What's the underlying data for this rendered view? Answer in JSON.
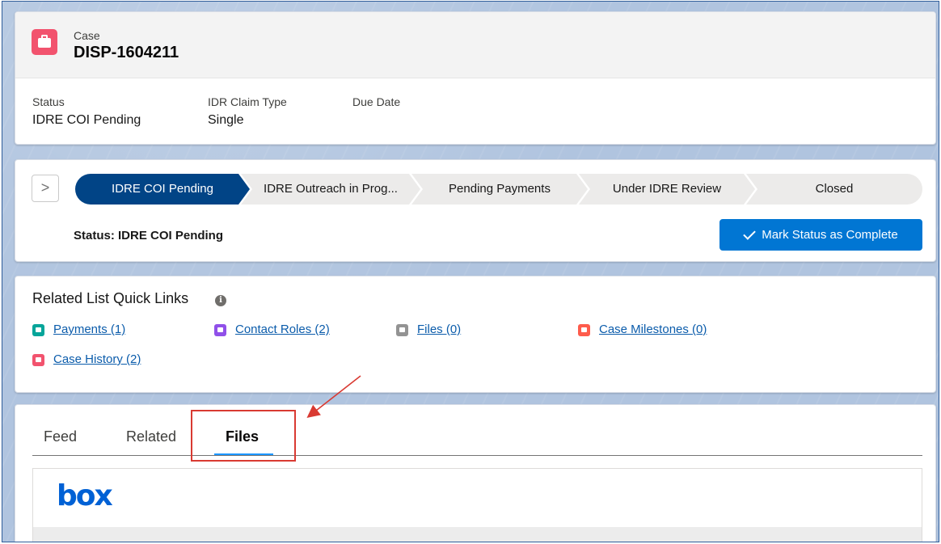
{
  "header": {
    "object_label": "Case",
    "record_number": "DISP-1604211",
    "fields": [
      {
        "label": "Status",
        "value": "IDRE COI Pending"
      },
      {
        "label": "IDR Claim Type",
        "value": "Single"
      },
      {
        "label": "Due Date",
        "value": ""
      }
    ]
  },
  "path": {
    "toggle_symbol": ">",
    "stages": [
      {
        "label": "IDRE COI Pending",
        "active": true
      },
      {
        "label": "IDRE Outreach in Prog...",
        "active": false
      },
      {
        "label": "Pending Payments",
        "active": false
      },
      {
        "label": "Under IDRE Review",
        "active": false
      },
      {
        "label": "Closed",
        "active": false
      }
    ],
    "status_text": "Status: IDRE COI Pending",
    "complete_button_label": "Mark Status as Complete",
    "active_color": "#014486",
    "button_color": "#0176d3"
  },
  "quick_links": {
    "title": "Related List Quick Links",
    "info_icon": "i",
    "links": [
      {
        "label": "Payments (1)",
        "icon": "payment-icon",
        "color": "#06a59a"
      },
      {
        "label": "Contact Roles (2)",
        "icon": "contact-role-icon",
        "color": "#9050e9"
      },
      {
        "label": "Files (0)",
        "icon": "file-icon",
        "color": "#939393"
      },
      {
        "label": "Case Milestones (0)",
        "icon": "milestone-icon",
        "color": "#fe5c4c"
      },
      {
        "label": "Case History (2)",
        "icon": "case-history-icon",
        "color": "#f2536e"
      }
    ]
  },
  "tabs": {
    "items": [
      {
        "label": "Feed",
        "active": false
      },
      {
        "label": "Related",
        "active": false
      },
      {
        "label": "Files",
        "active": true
      }
    ],
    "box_logo": "box"
  }
}
